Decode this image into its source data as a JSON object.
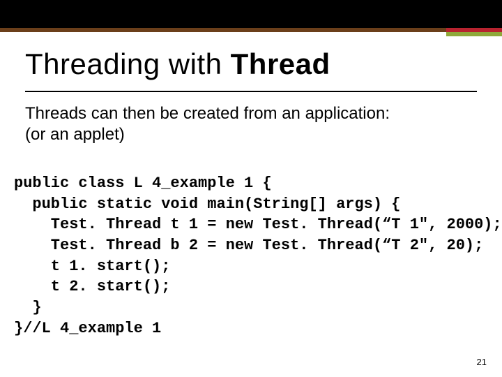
{
  "title_prefix": "Threading with ",
  "title_bold": "Thread",
  "description_line1": "Threads can then be created from an application:",
  "description_line2": "(or an applet)",
  "code": "public class L 4_example 1 {\n  public static void main(String[] args) {\n    Test. Thread t 1 = new Test. Thread(“T 1\", 2000);\n    Test. Thread b 2 = new Test. Thread(“T 2\", 20);\n    t 1. start();\n    t 2. start();\n  }\n}//L 4_example 1",
  "page_number": "21"
}
